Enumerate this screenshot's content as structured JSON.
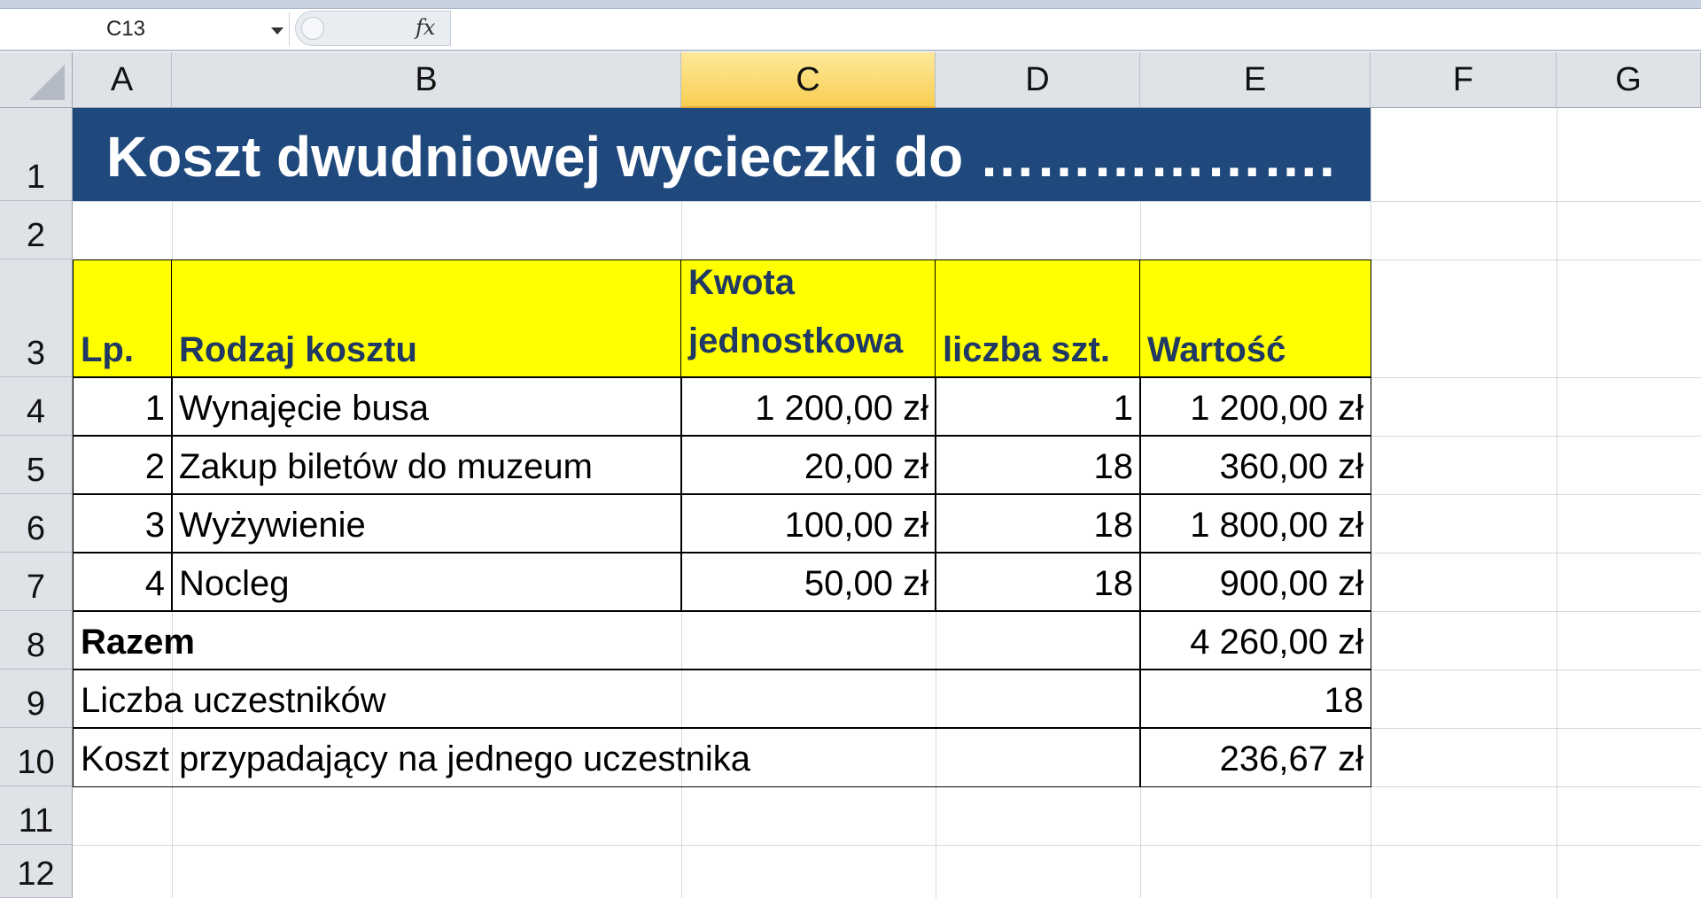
{
  "formula_bar": {
    "name_box": "C13",
    "fx_label": "fx",
    "formula": ""
  },
  "columns": [
    "A",
    "B",
    "C",
    "D",
    "E",
    "F",
    "G"
  ],
  "active_column": "C",
  "rows": [
    "1",
    "2",
    "3",
    "4",
    "5",
    "6",
    "7",
    "8",
    "9",
    "10",
    "11",
    "12"
  ],
  "sheet": {
    "title": "Koszt dwudniowej wycieczki do ……………….",
    "headers": {
      "lp": "Lp.",
      "rodzaj": "Rodzaj kosztu",
      "kwota_line1": "Kwota",
      "kwota_line2": "jednostkowa",
      "liczba": "liczba szt.",
      "wartosc": "Wartość"
    },
    "items": [
      {
        "lp": "1",
        "rodzaj": "Wynajęcie busa",
        "kwota": "1 200,00 zł",
        "liczba": "1",
        "wartosc": "1 200,00 zł"
      },
      {
        "lp": "2",
        "rodzaj": "Zakup biletów do muzeum",
        "kwota": "20,00 zł",
        "liczba": "18",
        "wartosc": "360,00 zł"
      },
      {
        "lp": "3",
        "rodzaj": "Wyżywienie",
        "kwota": "100,00 zł",
        "liczba": "18",
        "wartosc": "1 800,00 zł"
      },
      {
        "lp": "4",
        "rodzaj": "Nocleg",
        "kwota": "50,00 zł",
        "liczba": "18",
        "wartosc": "900,00 zł"
      }
    ],
    "summary": [
      {
        "label": "Razem",
        "value": "4 260,00 zł"
      },
      {
        "label": "Liczba uczestników",
        "value": "18"
      },
      {
        "label": "Koszt przypadający na jednego uczestnika",
        "value": "236,67 zł"
      }
    ]
  },
  "colors": {
    "title_band": "#1f497d",
    "header_fill": "#ffff00",
    "header_text": "#1f3864",
    "active_column_header": "#f7cf52"
  }
}
